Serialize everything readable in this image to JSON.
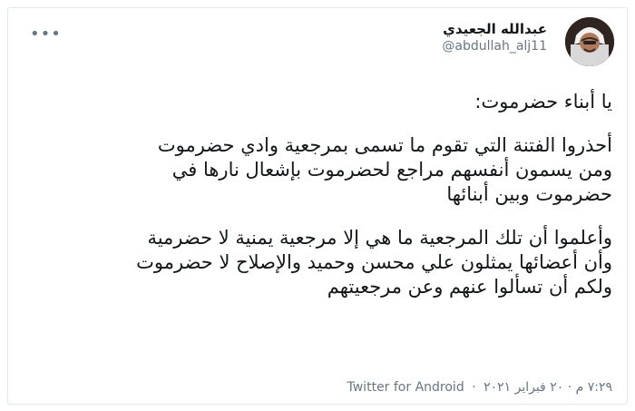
{
  "author": {
    "name": "عبدالله الجعيدي",
    "handle": "@abdullah_alj11"
  },
  "tweet": {
    "line1": "يا أبناء حضرموت:",
    "para2": "أحذروا الفتنة التي تقوم ما تسمى بمرجعية وادي حضرموت\nومن يسمون أنفسهم مراجع لحضرموت بإشعال نارها في\nحضرموت وبين أبنائها",
    "para3": "وأعلموا أن تلك المرجعية ما هي إلا مرجعية يمنية لا حضرمية\nوأن أعضائها يمثلون علي محسن وحميد والإصلاح لا حضرموت\nولكم أن تسألوا عنهم وعن مرجعيتهم"
  },
  "meta": {
    "timestamp": "٧:٢٩ م · ٢٠ فبراير ٢٠٢١",
    "separator": "·",
    "source": "Twitter for Android"
  },
  "icons": {
    "more": "more-options-icon",
    "avatar": "profile-avatar"
  }
}
